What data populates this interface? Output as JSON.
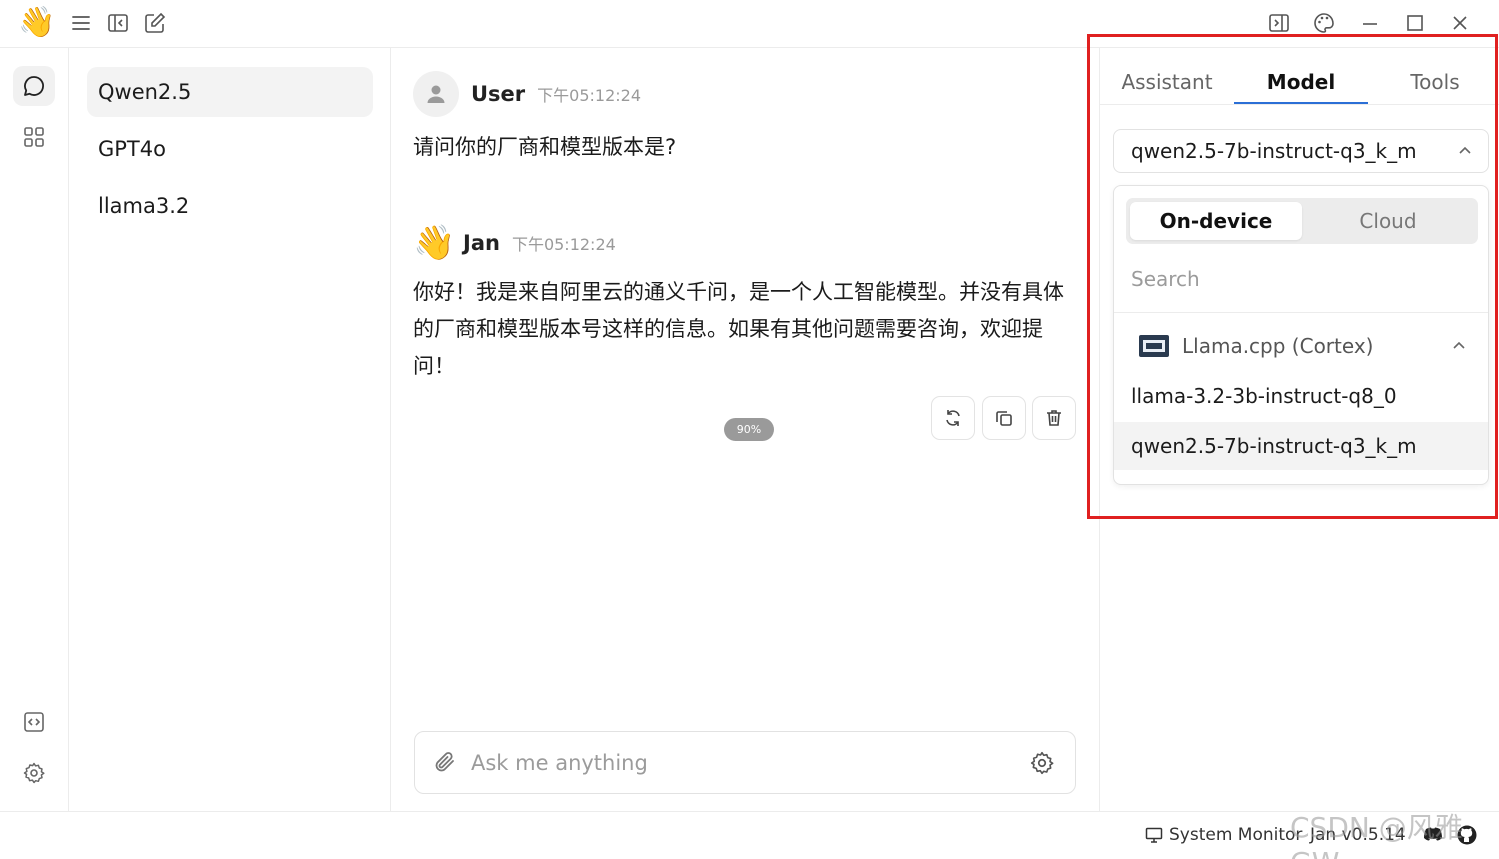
{
  "app": {
    "logo_emoji": "👋"
  },
  "threads": [
    {
      "title": "Qwen2.5",
      "active": true
    },
    {
      "title": "GPT4o",
      "active": false
    },
    {
      "title": "llama3.2",
      "active": false
    }
  ],
  "messages": [
    {
      "sender": "User",
      "time": "下午05:12:24",
      "text": "请问你的厂商和模型版本是?"
    },
    {
      "sender": "Jan",
      "time": "下午05:12:24",
      "text": "你好！我是来自阿里云的通义千问，是一个人工智能模型。并没有具体的厂商和模型版本号这样的信息。如果有其他问题需要咨询，欢迎提问！"
    }
  ],
  "zoom_badge": "90%",
  "input": {
    "placeholder": "Ask me anything",
    "value": ""
  },
  "panel": {
    "tabs": [
      {
        "label": "Assistant",
        "active": false
      },
      {
        "label": "Model",
        "active": true
      },
      {
        "label": "Tools",
        "active": false
      }
    ],
    "selected_model": "qwen2.5-7b-instruct-q3_k_m",
    "dropdown": {
      "segments": [
        {
          "label": "On-device",
          "active": true
        },
        {
          "label": "Cloud",
          "active": false
        }
      ],
      "search_placeholder": "Search",
      "engine": "Llama.cpp (Cortex)",
      "models": [
        {
          "name": "llama-3.2-3b-instruct-q8_0",
          "selected": false
        },
        {
          "name": "qwen2.5-7b-instruct-q3_k_m",
          "selected": true
        }
      ]
    }
  },
  "status": {
    "system_monitor": "System Monitor",
    "version": "Jan v0.5.14"
  },
  "watermark": "CSDN @风雅GW",
  "colors": {
    "accent": "#2b6fd6",
    "highlight_box": "#e02020",
    "badge": "#9a9a9a"
  }
}
